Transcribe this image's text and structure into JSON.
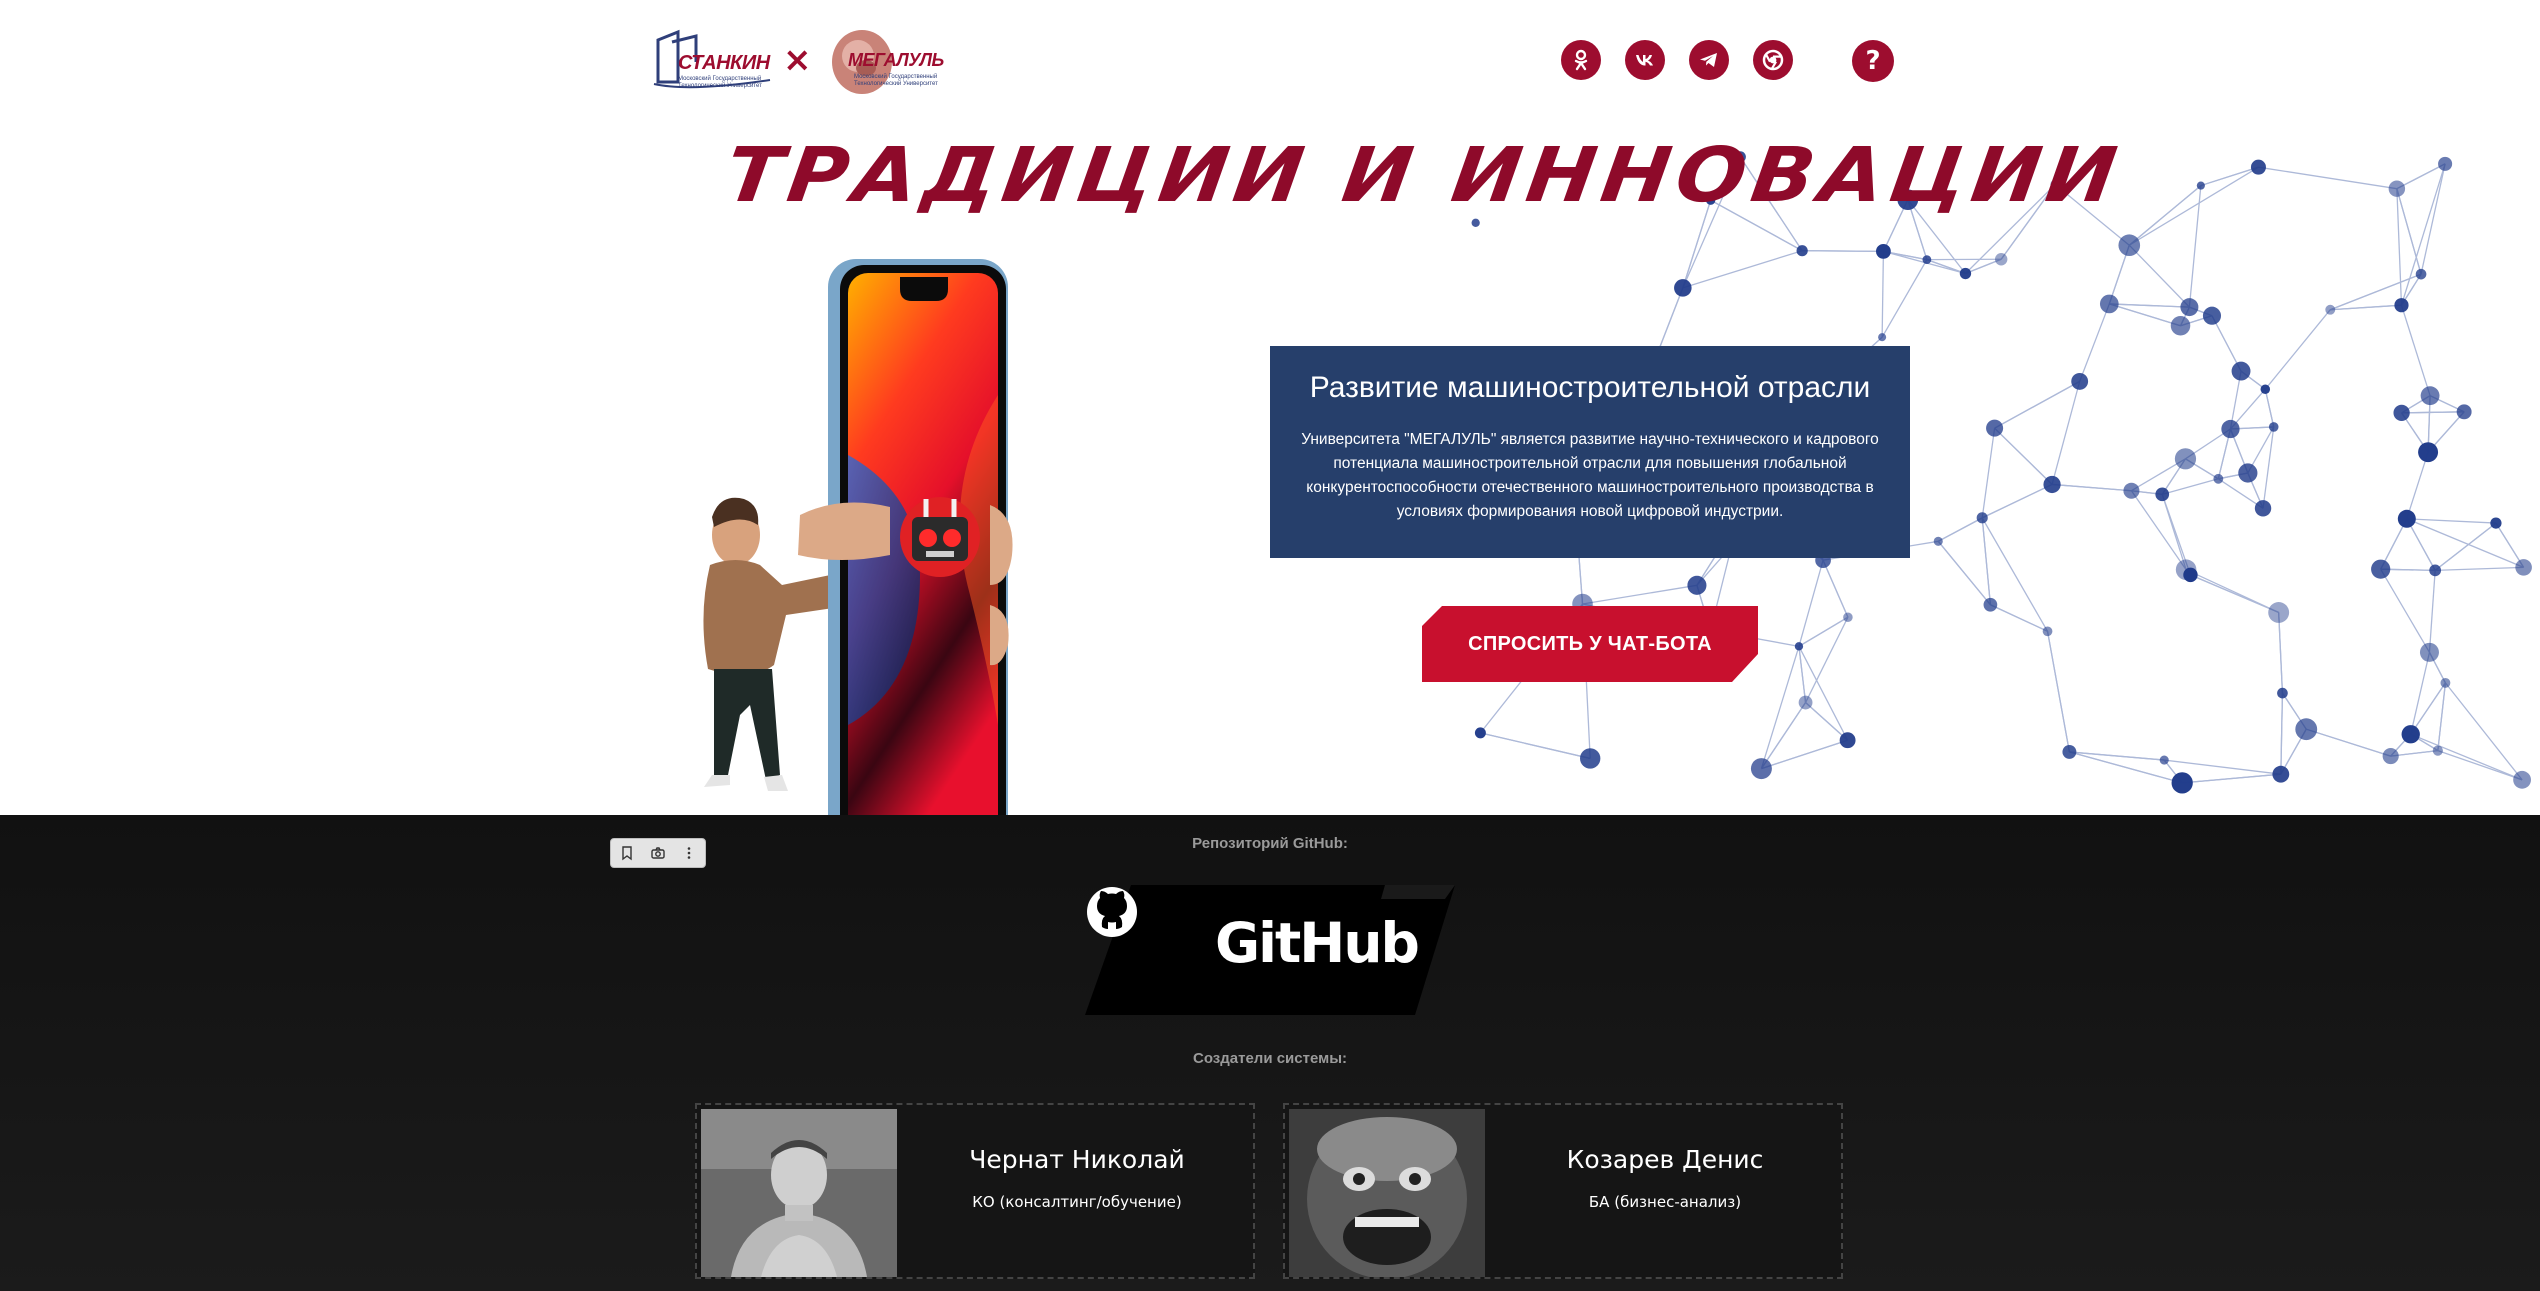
{
  "header": {
    "logos": [
      {
        "name": "СТАНКИН",
        "subtitle": "Московский Государственный Технологический Университет"
      },
      {
        "name": "МЕГАЛУЛЬ",
        "subtitle": "Московский Государственный Технологический Университет"
      }
    ],
    "separator": "×",
    "social_icons": [
      "odnoklassniki-icon",
      "vk-icon",
      "telegram-icon",
      "chrome-icon"
    ],
    "help_label": "?"
  },
  "hero": {
    "title": "ТРАДИЦИИ И ИННОВАЦИИ",
    "card_title": "Развитие машиностроительной отрасли",
    "card_text": "Университета \"МЕГАЛУЛЬ\" является развитие научно-технического и кадрового потенциала машиностроительной отрасли для повышения глобальной конкурентоспособности отечественного машиностроительного производства в условиях формирования новой цифровой индустрии.",
    "chat_button": "СПРОСИТЬ У ЧАТ-БОТА"
  },
  "footer": {
    "repo_label": "Репозиторий GitHub:",
    "github_text": "GitHub",
    "creators_label": "Создатели системы:",
    "creators": [
      {
        "name": "Чернат Николай",
        "role": "КО (консалтинг/обучение)"
      },
      {
        "name": "Козарев Денис",
        "role": "БА (бизнес-анализ)"
      }
    ]
  },
  "colors": {
    "brand": "#9d0d2f",
    "card": "#263f6b",
    "button": "#c8102e",
    "network": "#1f3a8a"
  }
}
